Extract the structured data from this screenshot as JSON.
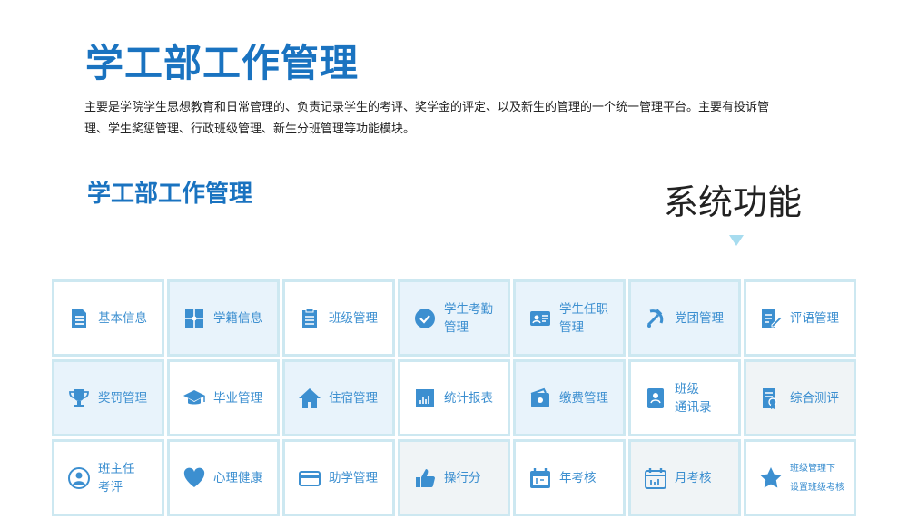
{
  "page": {
    "title": "学工部工作管理",
    "description": "主要是学院学生思想教育和日常管理的、负责记录学生的考评、奖学金的评定、以及新生的管理的一个统一管理平台。主要有投诉管理、学生奖惩管理、行政班级管理、新生分班管理等功能模块。",
    "subtitle": "学工部工作管理",
    "section_title": "系统功能"
  },
  "colors": {
    "brand_blue": "#1a73c0",
    "icon_blue": "#3c8fd0",
    "tile_border": "#cde8f1",
    "arrow": "#a7dcef"
  },
  "modules": [
    {
      "label": "基本信息",
      "icon": "document-icon"
    },
    {
      "label": "学籍信息",
      "icon": "book-icon"
    },
    {
      "label": "班级管理",
      "icon": "clipboard-icon"
    },
    {
      "label": "学生考勤\n管理",
      "icon": "check-circle-icon"
    },
    {
      "label": "学生任职\n管理",
      "icon": "id-card-icon"
    },
    {
      "label": "党团管理",
      "icon": "hammer-sickle-icon"
    },
    {
      "label": "评语管理",
      "icon": "edit-document-icon"
    },
    {
      "label": "奖罚管理",
      "icon": "trophy-icon"
    },
    {
      "label": "毕业管理",
      "icon": "graduation-cap-icon"
    },
    {
      "label": "住宿管理",
      "icon": "home-icon"
    },
    {
      "label": "统计报表",
      "icon": "bar-chart-icon"
    },
    {
      "label": "缴费管理",
      "icon": "wallet-icon"
    },
    {
      "label": "班级\n通讯录",
      "icon": "address-book-icon"
    },
    {
      "label": "综合测评",
      "icon": "certificate-icon"
    },
    {
      "label": "班主任\n考评",
      "icon": "person-circle-icon"
    },
    {
      "label": "心理健康",
      "icon": "heart-icon"
    },
    {
      "label": "助学管理",
      "icon": "credit-card-icon"
    },
    {
      "label": "操行分",
      "icon": "thumbs-up-icon"
    },
    {
      "label": "年考核",
      "icon": "calendar-icon"
    },
    {
      "label": "月考核",
      "icon": "calendar-chart-icon"
    },
    {
      "label": "班级管理下\n设置班级考核",
      "icon": "star-icon"
    }
  ]
}
